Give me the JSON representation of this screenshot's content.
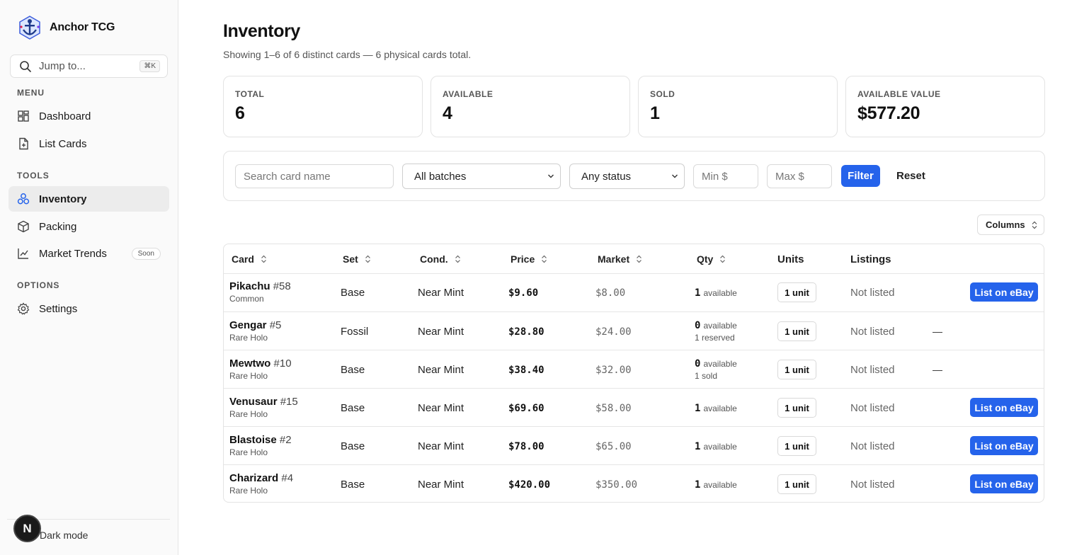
{
  "brand": {
    "name": "Anchor TCG"
  },
  "search": {
    "label": "Jump to...",
    "shortcut": "⌘K"
  },
  "sidebar": {
    "sections": [
      "MENU",
      "TOOLS",
      "OPTIONS"
    ],
    "items": [
      {
        "label": "Dashboard",
        "icon": "dashboard-icon"
      },
      {
        "label": "List Cards",
        "icon": "add-file-icon"
      },
      {
        "label": "Inventory",
        "icon": "inventory-icon",
        "active": true
      },
      {
        "label": "Packing",
        "icon": "package-icon"
      },
      {
        "label": "Market Trends",
        "icon": "chart-line-icon",
        "badge": "Soon"
      },
      {
        "label": "Settings",
        "icon": "gear-icon"
      }
    ],
    "avatar": "N",
    "dark_mode": "Dark mode"
  },
  "page": {
    "title": "Inventory",
    "subtitle": "Showing 1–6 of 6 distinct cards — 6 physical cards total."
  },
  "stats": [
    {
      "label": "TOTAL",
      "value": "6"
    },
    {
      "label": "AVAILABLE",
      "value": "4"
    },
    {
      "label": "SOLD",
      "value": "1"
    },
    {
      "label": "AVAILABLE VALUE",
      "value": "$577.20"
    }
  ],
  "filters": {
    "search_placeholder": "Search card name",
    "batch": "All batches",
    "status": "Any status",
    "min_placeholder": "Min $",
    "max_placeholder": "Max $",
    "filter_label": "Filter",
    "reset_label": "Reset"
  },
  "columns_label": "Columns",
  "table": {
    "headers": [
      "Card",
      "Set",
      "Cond.",
      "Price",
      "Market",
      "Qty",
      "Units",
      "Listings"
    ],
    "rows": [
      {
        "name": "Pikachu",
        "num": "#58",
        "rarity": "Common",
        "set": "Base",
        "cond": "Near Mint",
        "price": "$9.60",
        "market": "$8.00",
        "qty": "1",
        "qty_label": "available",
        "qty_sub": "",
        "units": "1 unit",
        "listing": "Not listed",
        "action": "List on eBay"
      },
      {
        "name": "Gengar",
        "num": "#5",
        "rarity": "Rare Holo",
        "set": "Fossil",
        "cond": "Near Mint",
        "price": "$28.80",
        "market": "$24.00",
        "qty": "0",
        "qty_label": "available",
        "qty_sub": "1 reserved",
        "units": "1 unit",
        "listing": "Not listed",
        "action": "—"
      },
      {
        "name": "Mewtwo",
        "num": "#10",
        "rarity": "Rare Holo",
        "set": "Base",
        "cond": "Near Mint",
        "price": "$38.40",
        "market": "$32.00",
        "qty": "0",
        "qty_label": "available",
        "qty_sub": "1 sold",
        "units": "1 unit",
        "listing": "Not listed",
        "action": "—"
      },
      {
        "name": "Venusaur",
        "num": "#15",
        "rarity": "Rare Holo",
        "set": "Base",
        "cond": "Near Mint",
        "price": "$69.60",
        "market": "$58.00",
        "qty": "1",
        "qty_label": "available",
        "qty_sub": "",
        "units": "1 unit",
        "listing": "Not listed",
        "action": "List on eBay"
      },
      {
        "name": "Blastoise",
        "num": "#2",
        "rarity": "Rare Holo",
        "set": "Base",
        "cond": "Near Mint",
        "price": "$78.00",
        "market": "$65.00",
        "qty": "1",
        "qty_label": "available",
        "qty_sub": "",
        "units": "1 unit",
        "listing": "Not listed",
        "action": "List on eBay"
      },
      {
        "name": "Charizard",
        "num": "#4",
        "rarity": "Rare Holo",
        "set": "Base",
        "cond": "Near Mint",
        "price": "$420.00",
        "market": "$350.00",
        "qty": "1",
        "qty_label": "available",
        "qty_sub": "",
        "units": "1 unit",
        "listing": "Not listed",
        "action": "List on eBay"
      }
    ]
  },
  "colors": {
    "accent": "#2563eb",
    "sidebar_bg": "#fafafa",
    "active_bg": "#ececec"
  }
}
